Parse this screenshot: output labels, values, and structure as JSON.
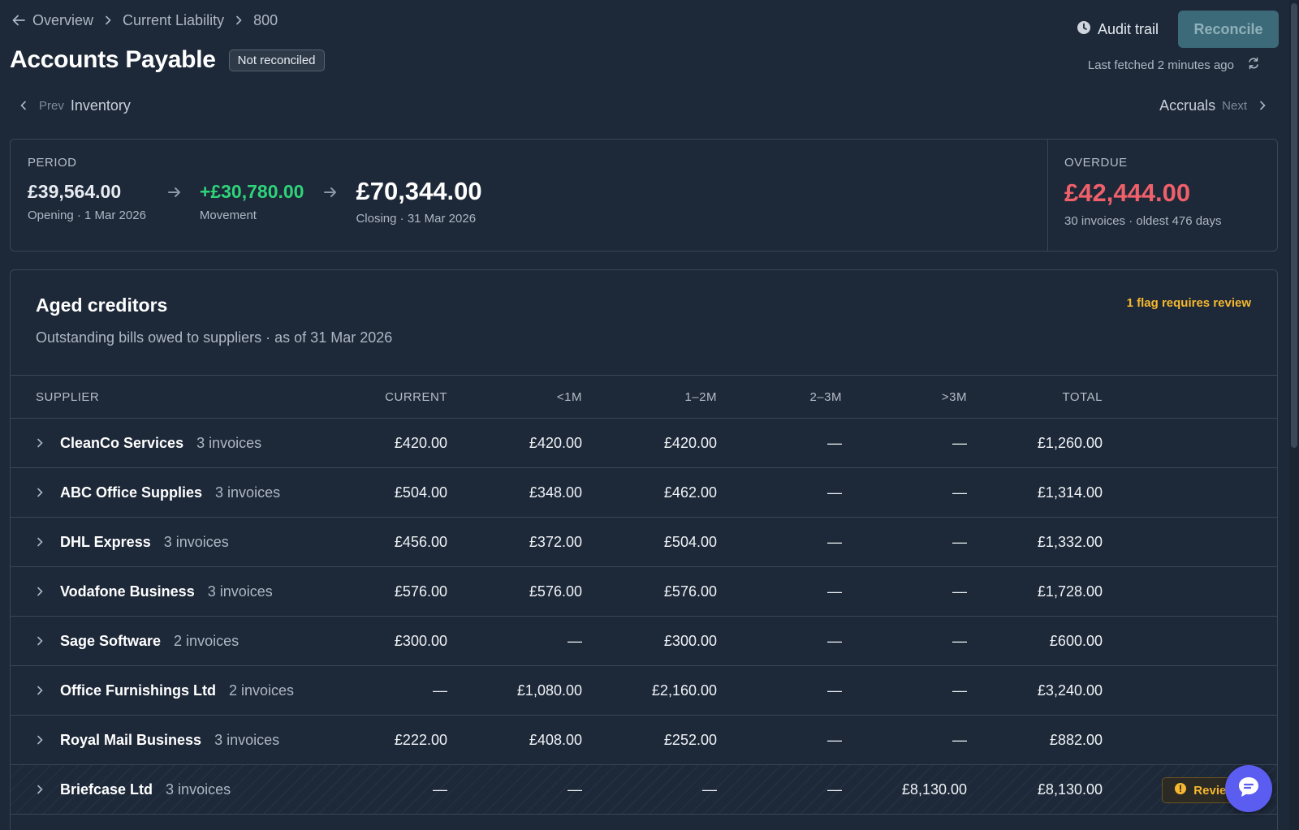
{
  "breadcrumb": {
    "items": [
      "Overview",
      "Current Liability",
      "800"
    ]
  },
  "page": {
    "title": "Accounts Payable",
    "status": "Not reconciled"
  },
  "actions": {
    "audit_trail": "Audit trail",
    "reconcile": "Reconcile"
  },
  "fetched": "Last fetched 2 minutes ago",
  "pager": {
    "prev_label": "Prev",
    "prev_name": "Inventory",
    "next_label": "Next",
    "next_name": "Accruals"
  },
  "summary": {
    "period_label": "PERIOD",
    "opening_amount": "£39,564.00",
    "opening_sub": "Opening · 1 Mar 2026",
    "movement_amount": "+£30,780.00",
    "movement_sub": "Movement",
    "closing_amount": "£70,344.00",
    "closing_sub": "Closing · 31 Mar 2026",
    "overdue_label": "OVERDUE",
    "overdue_amount": "£42,444.00",
    "overdue_sub": "30 invoices · oldest 476 days"
  },
  "aged": {
    "title": "Aged creditors",
    "subtitle": "Outstanding bills owed to suppliers · as of 31 Mar 2026",
    "flag_link": "1 flag requires review",
    "columns": [
      "SUPPLIER",
      "CURRENT",
      "<1M",
      "1–2M",
      "2–3M",
      ">3M",
      "TOTAL"
    ],
    "rows": [
      {
        "name": "CleanCo Services",
        "invoices": "3 invoices",
        "current": "£420.00",
        "m1": "£420.00",
        "m12": "£420.00",
        "m23": "—",
        "m3": "—",
        "total": "£1,260.00"
      },
      {
        "name": "ABC Office Supplies",
        "invoices": "3 invoices",
        "current": "£504.00",
        "m1": "£348.00",
        "m12": "£462.00",
        "m23": "—",
        "m3": "—",
        "total": "£1,314.00"
      },
      {
        "name": "DHL Express",
        "invoices": "3 invoices",
        "current": "£456.00",
        "m1": "£372.00",
        "m12": "£504.00",
        "m23": "—",
        "m3": "—",
        "total": "£1,332.00"
      },
      {
        "name": "Vodafone Business",
        "invoices": "3 invoices",
        "current": "£576.00",
        "m1": "£576.00",
        "m12": "£576.00",
        "m23": "—",
        "m3": "—",
        "total": "£1,728.00"
      },
      {
        "name": "Sage Software",
        "invoices": "2 invoices",
        "current": "£300.00",
        "m1": "—",
        "m12": "£300.00",
        "m23": "—",
        "m3": "—",
        "total": "£600.00"
      },
      {
        "name": "Office Furnishings Ltd",
        "invoices": "2 invoices",
        "current": "—",
        "m1": "£1,080.00",
        "m12": "£2,160.00",
        "m23": "—",
        "m3": "—",
        "total": "£3,240.00"
      },
      {
        "name": "Royal Mail Business",
        "invoices": "3 invoices",
        "current": "£222.00",
        "m1": "£408.00",
        "m12": "£252.00",
        "m23": "—",
        "m3": "—",
        "total": "£882.00"
      },
      {
        "name": "Briefcase Ltd",
        "invoices": "3 invoices",
        "current": "—",
        "m1": "—",
        "m12": "—",
        "m23": "—",
        "m3": "£8,130.00",
        "total": "£8,130.00",
        "flag": "Review"
      }
    ]
  },
  "icons": {
    "back": "arrow-left-icon",
    "audit": "clock-icon",
    "refresh": "refresh-icon",
    "chat": "chat-icon"
  },
  "colors": {
    "accent_green": "#2ed47a",
    "overdue_red": "#f0606a",
    "flag_amber": "#f5b82e",
    "chat_purple": "#5b5df0"
  }
}
